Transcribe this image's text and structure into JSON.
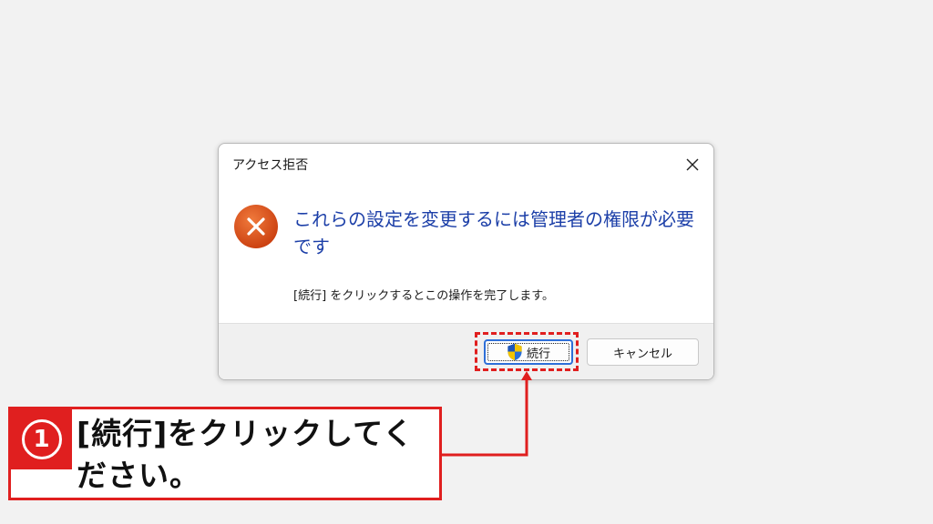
{
  "dialog": {
    "title": "アクセス拒否",
    "main_instruction": "これらの設定を変更するには管理者の権限が必要です",
    "content": "[続行] をクリックするとこの操作を完了します。",
    "continue_label": "続行",
    "cancel_label": "キャンセル"
  },
  "callout": {
    "number": "1",
    "text": "[続行]をクリックしてください。"
  },
  "colors": {
    "accent_red": "#e01f1f",
    "error_icon": "#d84b16",
    "instruction_blue": "#1c3fa8"
  },
  "icons": {
    "close": "close-icon",
    "error": "error-icon",
    "uac_shield": "shield-icon"
  }
}
